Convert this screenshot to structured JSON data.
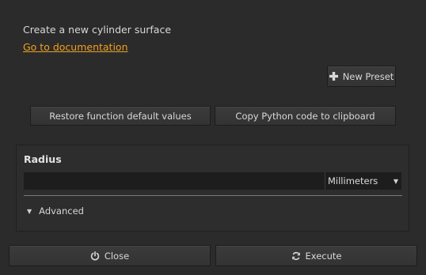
{
  "description": "Create a new cylinder surface",
  "doc_link": "Go to documentation",
  "buttons": {
    "new_preset": "New Preset",
    "restore_defaults": "Restore function default values",
    "copy_python": "Copy Python code to clipboard",
    "close": "Close",
    "execute": "Execute"
  },
  "params": {
    "radius_label": "Radius",
    "radius_value": "",
    "unit": "Millimeters",
    "advanced_label": "Advanced"
  },
  "icons": {
    "new_preset": "plus-icon",
    "close": "power-icon",
    "execute": "refresh-icon",
    "unit_dropdown": "chevron-down-icon",
    "advanced": "triangle-down-icon"
  },
  "colors": {
    "background": "#2b2b2b",
    "link": "#f0a020",
    "input_background": "#1d1d1d"
  }
}
